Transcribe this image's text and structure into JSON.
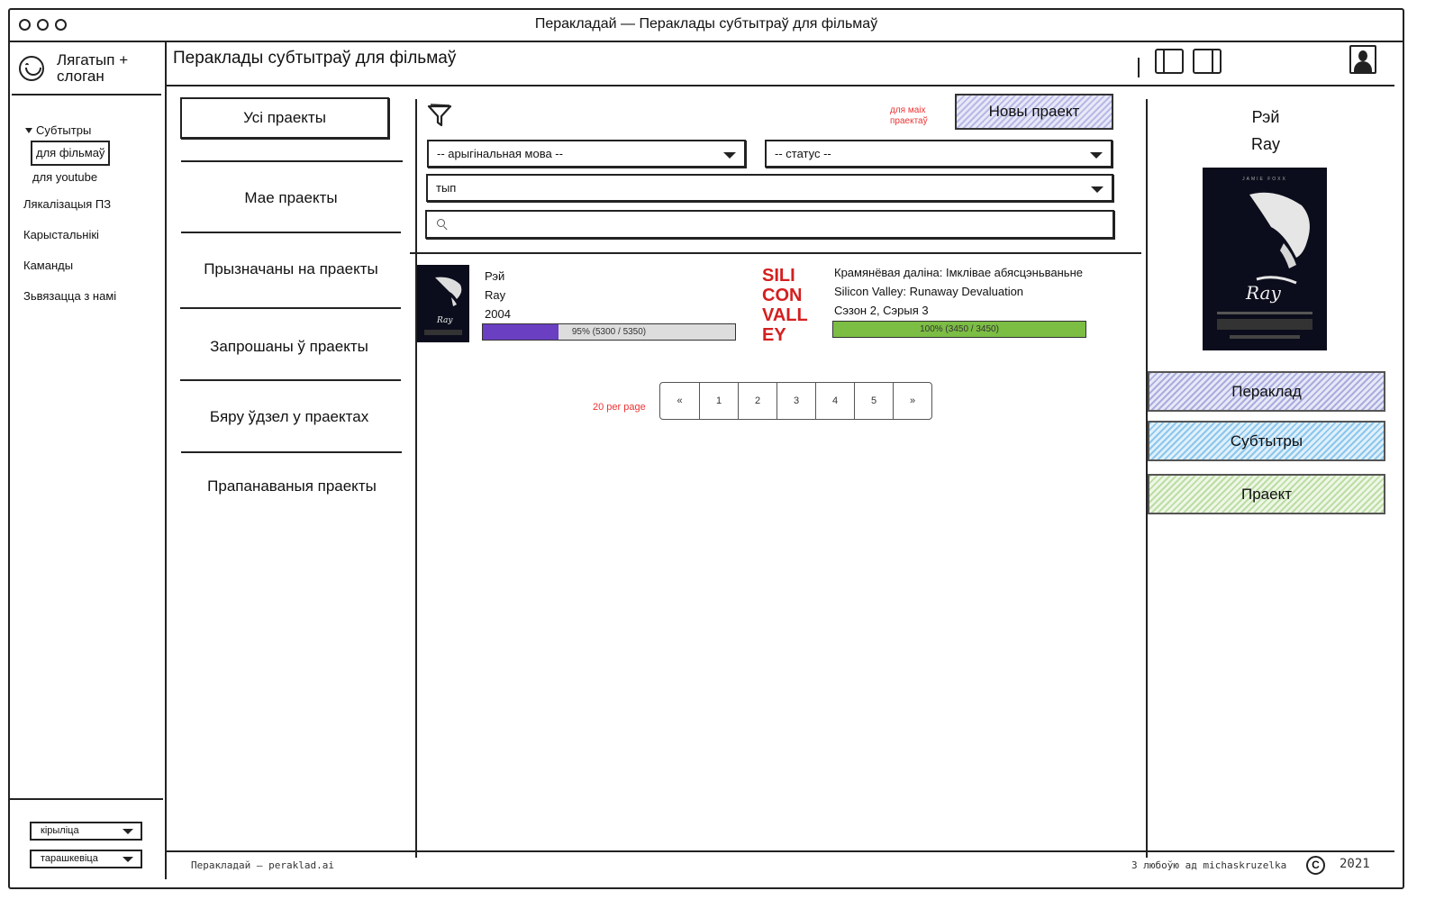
{
  "window": {
    "title": "Перакладай — Пераклады субтытраў для фільмаў"
  },
  "sidebar": {
    "logo_text": "Лягатып + слоган",
    "nav": {
      "group": "Субтытры",
      "sub_items": [
        "для фільмаў",
        "для youtube"
      ],
      "items": [
        "Лякалізацыя ПЗ",
        "Карыстальнікі",
        "Каманды",
        "Зьвязацца з намі"
      ]
    },
    "script_select": "кірыліца",
    "orthography_select": "тарашкевіца"
  },
  "header": {
    "title": "Пераклады субтытраў для фільмаў"
  },
  "project_tabs": [
    "Усі праекты",
    "Мае праекты",
    "Прызначаны на праекты",
    "Запрошаны ў праекты",
    "Бяру ўдзел у праектах",
    "Прапанаваныя праекты"
  ],
  "toolbar": {
    "red_note": "для маіх праектаў",
    "new_project": "Новы праект"
  },
  "filters": {
    "original_language": "-- арыгінальная мова --",
    "status": "-- статус --",
    "type": "тып",
    "search_placeholder": ""
  },
  "projects": [
    {
      "title_be": "Рэй",
      "title_en": "Ray",
      "meta": "2004",
      "progress_label": "95% (5300 / 5350)",
      "progress": 0.3,
      "color": "#6a3fc2"
    },
    {
      "title_be": "Крамянёвая даліна: Імклівае абясцэньваньне",
      "title_en": "Silicon Valley: Runaway Devaluation",
      "meta": "Сэзон 2, Сэрыя 3",
      "progress_label": "100% (3450 / 3450)",
      "progress": 1.0,
      "color": "#7cbd44"
    }
  ],
  "pagination": {
    "per_page": "20 per page",
    "pages": [
      "«",
      "1",
      "2",
      "3",
      "4",
      "5",
      "»"
    ]
  },
  "right_panel": {
    "title_be": "Рэй",
    "title_en": "Ray",
    "buttons": [
      "Пераклад",
      "Субтытры",
      "Праект"
    ]
  },
  "footer": {
    "left": "Перакладай — peraklad.ai",
    "right": "З любоўю ад michaskruzelka",
    "copyright_symbol": "C",
    "year": "2021"
  }
}
